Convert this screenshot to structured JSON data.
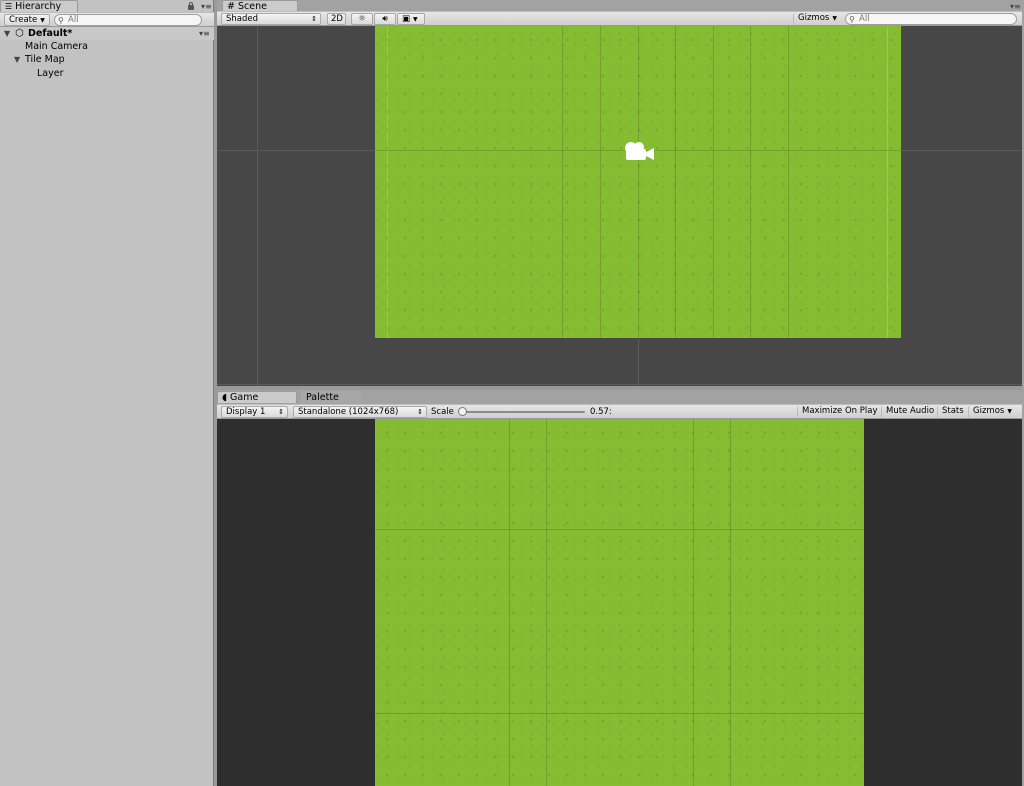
{
  "hierarchy": {
    "tab_label": "Hierarchy",
    "create_label": "Create",
    "search_placeholder": "All",
    "scene_name": "Default*",
    "items": [
      {
        "label": "Main Camera"
      },
      {
        "label": "Tile Map"
      },
      {
        "label": "Layer"
      }
    ]
  },
  "scene": {
    "tab_label": "Scene",
    "shading_mode": "Shaded",
    "mode_2d": "2D",
    "gizmos_label": "Gizmos",
    "search_placeholder": "All",
    "icons": [
      "sun-icon",
      "speaker-icon",
      "image-icon"
    ]
  },
  "game": {
    "tab_label": "Game",
    "palette_tab_label": "Palette",
    "display": "Display 1",
    "resolution": "Standalone (1024x768)",
    "scale_label": "Scale",
    "scale_value": "0.57:",
    "maximize_label": "Maximize On Play",
    "mute_label": "Mute Audio",
    "stats_label": "Stats",
    "gizmos_label": "Gizmos"
  },
  "colors": {
    "grass": "#86bc32",
    "scene_bg": "#474747",
    "game_bg": "#2e2e2e",
    "panel_bg": "#c2c2c2"
  }
}
